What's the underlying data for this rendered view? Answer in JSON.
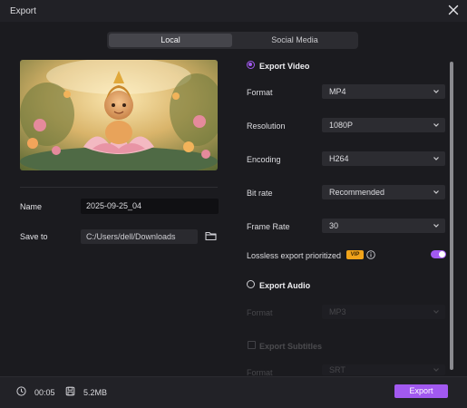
{
  "window": {
    "title": "Export",
    "close_icon": "close-icon"
  },
  "tabs": [
    {
      "label": "Local",
      "active": true
    },
    {
      "label": "Social Media",
      "active": false
    }
  ],
  "left": {
    "name_label": "Name",
    "name_value": "2025-09-25_04",
    "save_label": "Save to",
    "save_path": "C:/Users/dell/Downloads",
    "folder_icon": "folder-icon"
  },
  "export_video": {
    "title": "Export Video",
    "selected": true,
    "fields": [
      {
        "label": "Format",
        "value": "MP4"
      },
      {
        "label": "Resolution",
        "value": "1080P"
      },
      {
        "label": "Encoding",
        "value": "H264"
      },
      {
        "label": "Bit rate",
        "value": "Recommended"
      },
      {
        "label": "Frame Rate",
        "value": "30"
      }
    ],
    "lossless_label": "Lossless export prioritized",
    "vip_badge": "VIP",
    "lossless_enabled": true
  },
  "export_audio": {
    "title": "Export Audio",
    "selected": false,
    "format_label": "Format",
    "format_value": "MP3"
  },
  "export_subtitles": {
    "title": "Export Subtitles",
    "checked": false,
    "format_label": "Format",
    "format_value": "SRT"
  },
  "footer": {
    "duration": "00:05",
    "size": "5.2MB",
    "export_label": "Export"
  },
  "colors": {
    "accent": "#a259f0",
    "vip": "#f0a31a",
    "background": "#1b1b1f"
  }
}
